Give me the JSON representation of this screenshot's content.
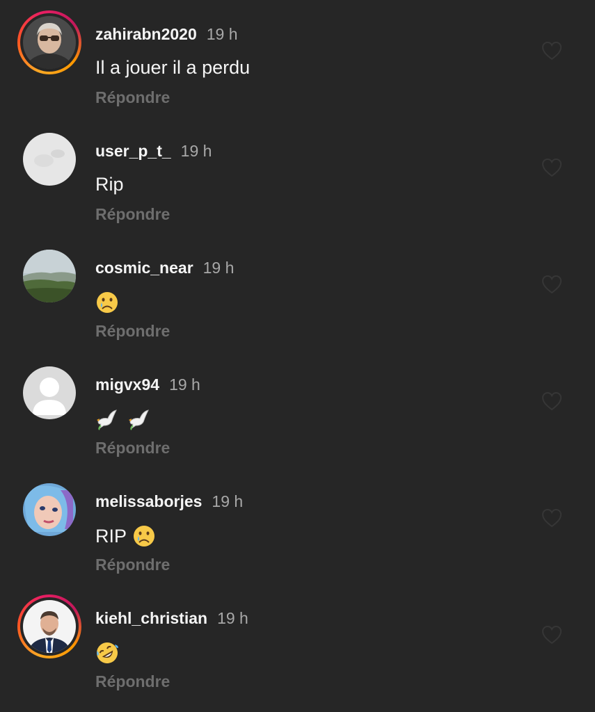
{
  "reply_label": "Répondre",
  "comments": [
    {
      "username": "zahirabn2020",
      "time": "19 h",
      "text": "Il a jouer  il a perdu",
      "emojis": [],
      "avatar": "person-sunglasses",
      "story_ring": true
    },
    {
      "username": "user_p_t_",
      "time": "19 h",
      "text": "Rip",
      "emojis": [],
      "avatar": "light-gray-texture",
      "story_ring": false
    },
    {
      "username": "cosmic_near",
      "time": "19 h",
      "text": "",
      "emojis": [
        "crying-face"
      ],
      "avatar": "landscape",
      "story_ring": false
    },
    {
      "username": "migvx94",
      "time": "19 h",
      "text": "",
      "emojis": [
        "dove",
        "dove"
      ],
      "avatar": "default-user",
      "story_ring": false
    },
    {
      "username": "melissaborjes",
      "time": "19 h",
      "text": "RIP",
      "emojis": [
        "crying-face"
      ],
      "avatar": "woman-blue-hair",
      "story_ring": false
    },
    {
      "username": "kiehl_christian",
      "time": "19 h",
      "text": "",
      "emojis": [
        "rolling-laughing-face"
      ],
      "avatar": "man-in-suit",
      "story_ring": true
    }
  ],
  "colors": {
    "background": "#262626",
    "username": "#f5f5f5",
    "time": "#a8a8a8",
    "reply": "#6e6e6e",
    "heart_outline": "#363636"
  }
}
